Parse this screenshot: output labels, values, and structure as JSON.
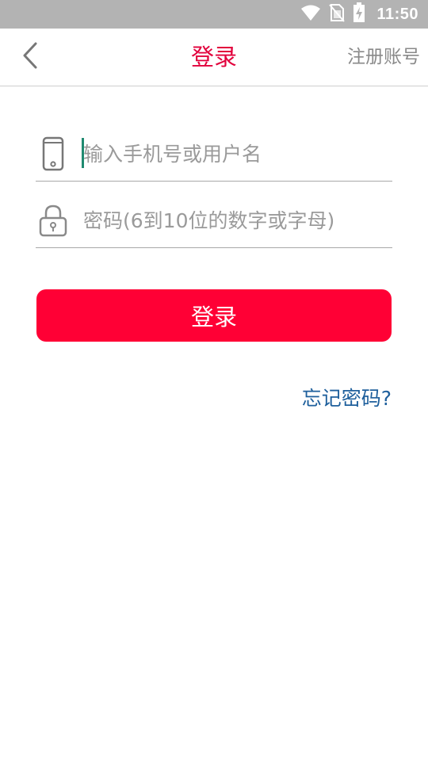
{
  "status_bar": {
    "time": "11:50",
    "icons": [
      "wifi-icon",
      "no-sim-icon",
      "battery-charging-icon"
    ],
    "background_color": "#b3b3b3"
  },
  "header": {
    "title": "登录",
    "register_label": "注册账号",
    "back_icon": "chevron-left-icon",
    "title_color": "#e2003c"
  },
  "form": {
    "username": {
      "placeholder": "输入手机号或用户名",
      "value": "",
      "icon": "phone-icon"
    },
    "password": {
      "placeholder": "密码(6到10位的数字或字母)",
      "value": "",
      "icon": "lock-icon"
    },
    "login_button_label": "登录",
    "login_button_color": "#ff0035",
    "forgot_password_label": "忘记密码?",
    "forgot_color": "#1e5f9c"
  }
}
